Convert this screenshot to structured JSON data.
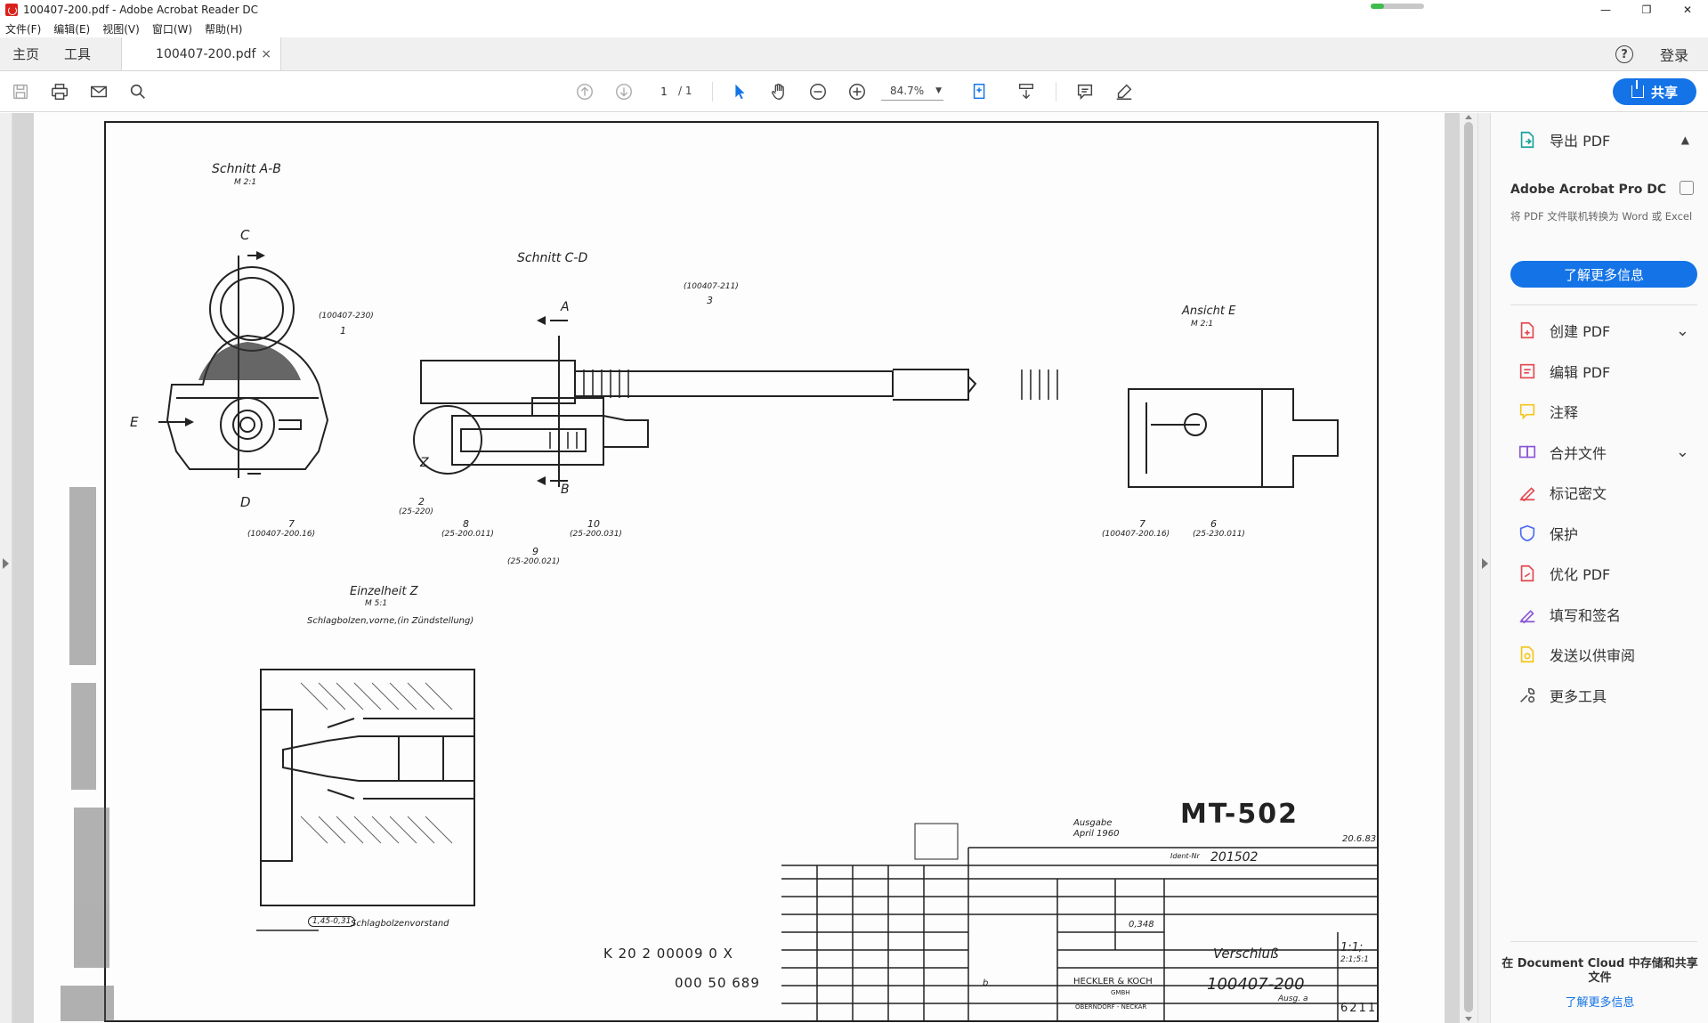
{
  "window": {
    "title": "100407-200.pdf - Adobe Acrobat Reader DC",
    "buttons": [
      "minimize",
      "maximize",
      "close"
    ],
    "progress": 0.25,
    "progress_color": "#3fbd4f"
  },
  "menu": [
    "文件(F)",
    "编辑(E)",
    "视图(V)",
    "窗口(W)",
    "帮助(H)"
  ],
  "tabs": {
    "home": "主页",
    "tools": "工具",
    "document": "100407-200.pdf",
    "close": "×",
    "help": "?",
    "login": "登录"
  },
  "toolbar": {
    "page_current": "1",
    "page_total": "/ 1",
    "zoom": "84.7%",
    "share": "共享",
    "accent": "#1473e6"
  },
  "drawing": {
    "schnitt_ab": "Schnitt A-B",
    "schnitt_ab_scale": "M 2:1",
    "schnitt_cd": "Schnitt C-D",
    "ansicht_e": "Ansicht E",
    "ansicht_e_scale": "M 2:1",
    "einzelheit_z": "Einzelheit Z",
    "einzelheit_scale": "M 5:1",
    "einzelheit_caption": "Schlagbolzen,vorne,(in Zündstellung)",
    "schlagbolzen_vorstand": "Schlagbolzenvorstand",
    "vorstand_dim": "1,45-0,31",
    "label_c": "C",
    "label_d": "D",
    "label_e": "E",
    "label_a": "A",
    "label_b": "B",
    "label_z": "Z",
    "ref_230": "(100407-230)",
    "ref_1": "1",
    "ref_211": "(100407-211)",
    "ref_3": "3",
    "ref_7a": "7",
    "ref_7a_part": "(100407-200.16)",
    "ref_2": "2",
    "ref_2_part": "(25-220)",
    "ref_8": "8",
    "ref_8_part": "(25-200.011)",
    "ref_9": "9",
    "ref_9_part": "(25-200.021)",
    "ref_10": "10",
    "ref_10_part": "(25-200.031)",
    "ref_7b": "7",
    "ref_7b_part": "(100407-200.16)",
    "ref_6": "6",
    "ref_6_part": "(25-230.011)",
    "mt_number": "MT-502",
    "ausgabe": "Ausgabe",
    "ausgabe_date": "April 1960",
    "ident_label": "Ident-Nr",
    "ident_nr": "201502",
    "benennung": "Verschluß",
    "zeichnung_nr": "100407-200",
    "company": "HECKLER & KOCH",
    "company_sub": "GMBH",
    "company_city": "OBERNDORF - NECKAR",
    "scale_main": "1:1;",
    "scale_alt": "2:1;5:1",
    "gewicht": "0,348",
    "blatt": "6211",
    "code_line1": "K   20   2   00009   0   X",
    "code_line2": "000  50  689",
    "rev_date": "20.6.83",
    "rev_b": "b",
    "ausg_a": "Ausg. a"
  },
  "right_panel": {
    "export": "导出 PDF",
    "pro_title": "Adobe Acrobat Pro DC",
    "pro_desc": "将 PDF 文件联机转换为 Word 或 Excel",
    "learn_more": "了解更多信息",
    "tools": [
      {
        "label": "创建 PDF",
        "icon": "create-pdf-icon",
        "color": "#e34850",
        "chevron": true
      },
      {
        "label": "编辑 PDF",
        "icon": "edit-pdf-icon",
        "color": "#e34850",
        "chevron": false
      },
      {
        "label": "注释",
        "icon": "comment-icon",
        "color": "#f5c518",
        "chevron": false
      },
      {
        "label": "合并文件",
        "icon": "combine-files-icon",
        "color": "#8a55d8",
        "chevron": true
      },
      {
        "label": "标记密文",
        "icon": "redact-icon",
        "color": "#e34850",
        "chevron": false
      },
      {
        "label": "保护",
        "icon": "protect-icon",
        "color": "#4a6cf0",
        "chevron": false
      },
      {
        "label": "优化 PDF",
        "icon": "optimize-pdf-icon",
        "color": "#e34850",
        "chevron": false
      },
      {
        "label": "填写和签名",
        "icon": "fill-sign-icon",
        "color": "#8a55d8",
        "chevron": false
      },
      {
        "label": "发送以供审阅",
        "icon": "send-review-icon",
        "color": "#f5c518",
        "chevron": false
      },
      {
        "label": "更多工具",
        "icon": "more-tools-icon",
        "color": "#555555",
        "chevron": false
      }
    ],
    "cloud_title": "在 Document Cloud 中存储和共享文件",
    "cloud_link": "了解更多信息"
  }
}
